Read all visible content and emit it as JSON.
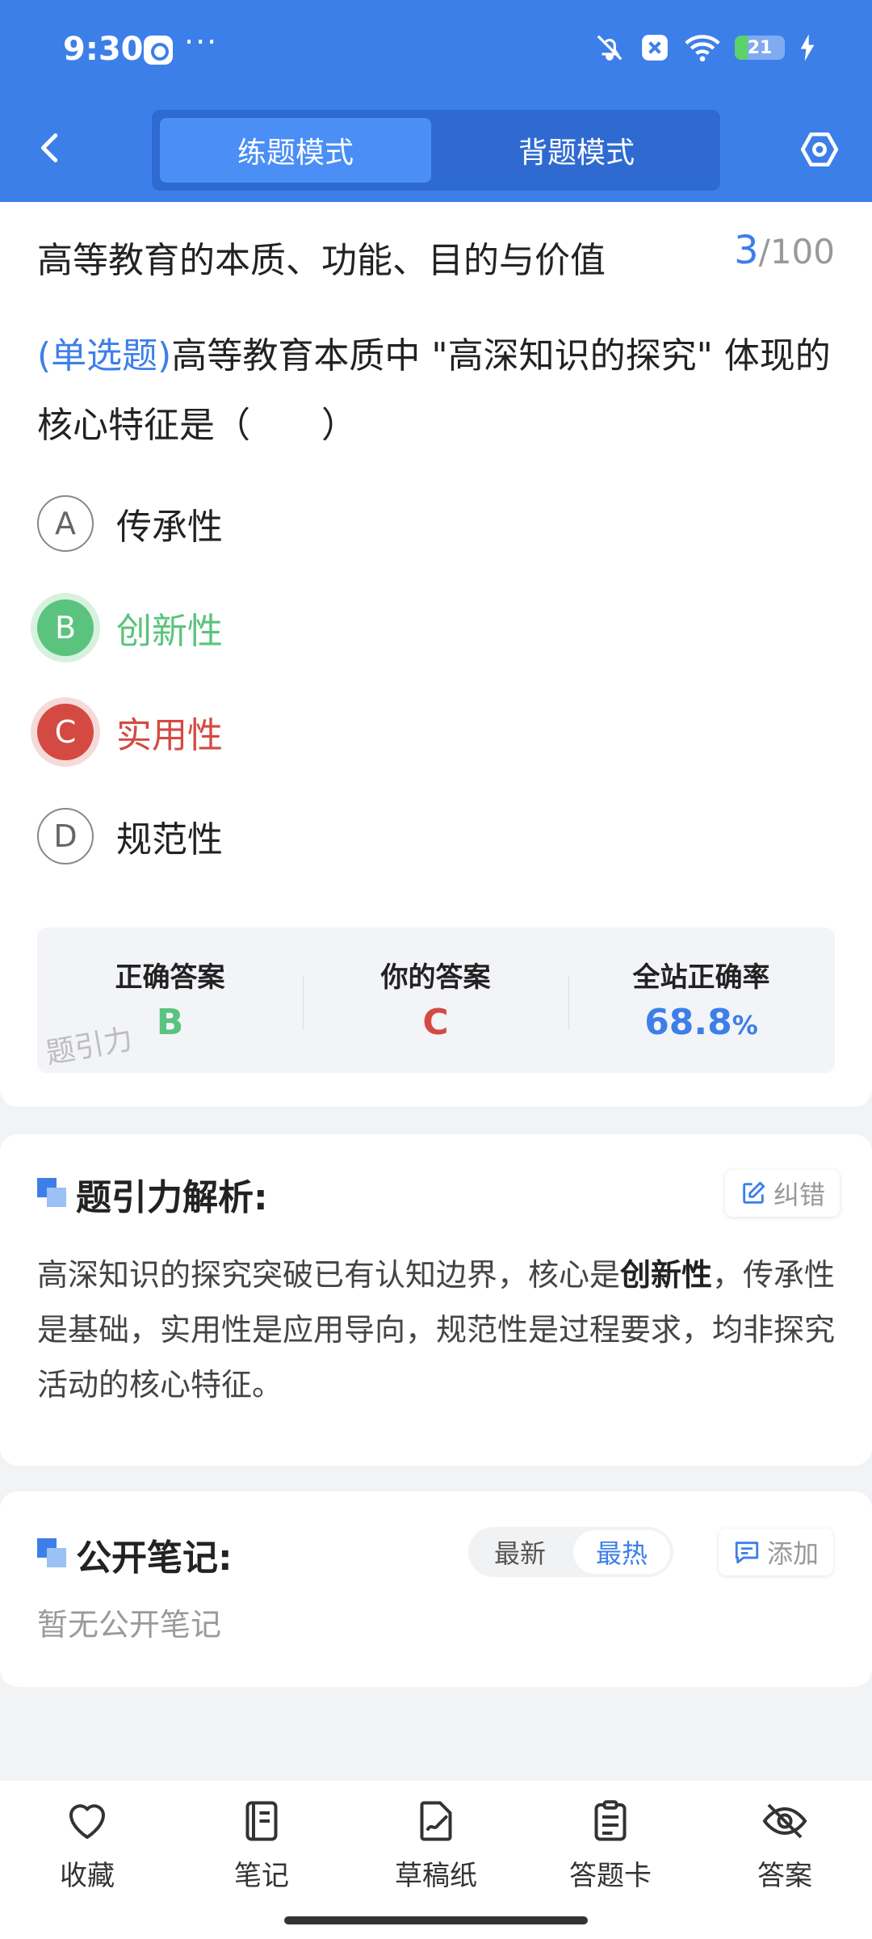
{
  "status_bar": {
    "time": "9:30",
    "dots": "···",
    "battery": "21"
  },
  "header": {
    "tabs": [
      "练题模式",
      "背题模式"
    ]
  },
  "title_row": {
    "title": "高等教育的本质、功能、目的与价值",
    "current": "3",
    "sep": "/",
    "total": "100"
  },
  "question": {
    "type_label": "(单选题)",
    "text": "高等教育本质中 \"高深知识的探究\" 体现的核心特征是（　　）",
    "options": [
      {
        "letter": "A",
        "label": "传承性",
        "state": "normal"
      },
      {
        "letter": "B",
        "label": "创新性",
        "state": "correct"
      },
      {
        "letter": "C",
        "label": "实用性",
        "state": "wrong"
      },
      {
        "letter": "D",
        "label": "规范性",
        "state": "normal"
      }
    ]
  },
  "answer_box": {
    "correct_label": "正确答案",
    "correct_value": "B",
    "yours_label": "你的答案",
    "yours_value": "C",
    "rate_label": "全站正确率",
    "rate_value": "68.8",
    "rate_unit": "%",
    "watermark": "题引力"
  },
  "analysis": {
    "title": "题引力解析:",
    "correct_btn": "纠错",
    "text_before": "高深知识的探究突破已有认知边界，核心是",
    "text_bold": "创新性",
    "text_after": "，传承性是基础，实用性是应用导向，规范性是过程要求，均非探究活动的核心特征。"
  },
  "notes": {
    "title": "公开笔记:",
    "sort_latest": "最新",
    "sort_hot": "最热",
    "add_btn": "添加",
    "empty": "暂无公开笔记"
  },
  "bottom_bar": {
    "items": [
      "收藏",
      "笔记",
      "草稿纸",
      "答题卡",
      "答案"
    ]
  },
  "colors": {
    "primary": "#3d7fe9",
    "correct": "#5ac37d",
    "wrong": "#d44a42"
  },
  "icons": [
    "back-icon",
    "settings-hexagon-icon",
    "heart-icon",
    "notebook-icon",
    "draft-icon",
    "answer-card-icon",
    "eye-off-icon",
    "edit-icon",
    "comment-icon"
  ]
}
